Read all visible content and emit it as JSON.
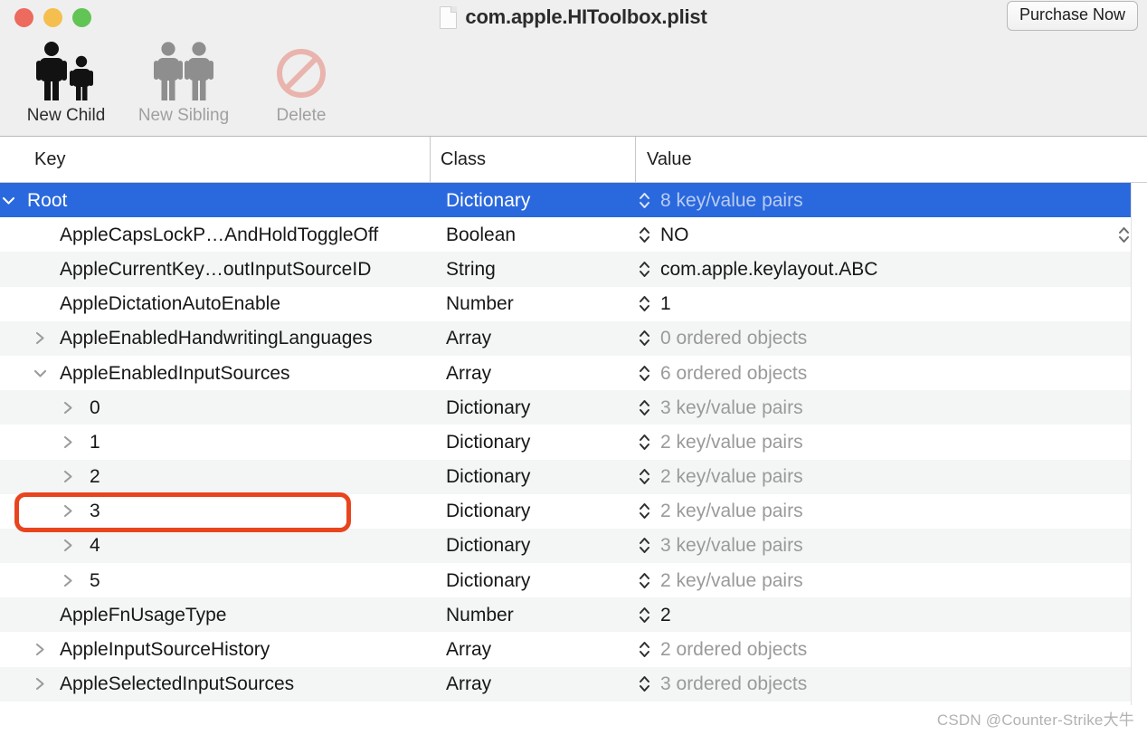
{
  "window": {
    "title": "com.apple.HIToolbox.plist",
    "traffic_lights": [
      "close",
      "minimize",
      "zoom"
    ],
    "purchase_button": "Purchase Now",
    "accent_selected": "#2a68dd",
    "annotation_color": "#e8451f"
  },
  "toolbar": {
    "items": [
      {
        "label": "New Child",
        "icon": "two-people-parent-child-icon",
        "enabled": true
      },
      {
        "label": "New Sibling",
        "icon": "two-people-siblings-icon",
        "enabled": false
      },
      {
        "label": "Delete",
        "icon": "prohibition-sign-icon",
        "enabled": false
      }
    ]
  },
  "table": {
    "columns": [
      "Key",
      "Class",
      "Value"
    ],
    "rows": [
      {
        "key": "Root",
        "class": "Dictionary",
        "value": "8 key/value pairs",
        "level": 0,
        "disclosure": "expanded",
        "selected": true,
        "muted_value": true,
        "stepper": true
      },
      {
        "key": "AppleCapsLockP…AndHoldToggleOff",
        "class": "Boolean",
        "value": "NO",
        "level": 1,
        "disclosure": "none",
        "selected": false,
        "muted_value": false,
        "stepper": true,
        "right_popup": true
      },
      {
        "key": "AppleCurrentKey…outInputSourceID",
        "class": "String",
        "value": "com.apple.keylayout.ABC",
        "level": 1,
        "disclosure": "none",
        "selected": false,
        "muted_value": false,
        "stepper": true
      },
      {
        "key": "AppleDictationAutoEnable",
        "class": "Number",
        "value": "1",
        "level": 1,
        "disclosure": "none",
        "selected": false,
        "muted_value": false,
        "stepper": true
      },
      {
        "key": "AppleEnabledHandwritingLanguages",
        "class": "Array",
        "value": "0 ordered objects",
        "level": 1,
        "disclosure": "collapsed",
        "selected": false,
        "muted_value": true,
        "stepper": true
      },
      {
        "key": "AppleEnabledInputSources",
        "class": "Array",
        "value": "6 ordered objects",
        "level": 1,
        "disclosure": "expanded",
        "selected": false,
        "muted_value": true,
        "stepper": true,
        "annotated": true
      },
      {
        "key": "0",
        "class": "Dictionary",
        "value": "3 key/value pairs",
        "level": 2,
        "disclosure": "collapsed",
        "selected": false,
        "muted_value": true,
        "stepper": true
      },
      {
        "key": "1",
        "class": "Dictionary",
        "value": "2 key/value pairs",
        "level": 2,
        "disclosure": "collapsed",
        "selected": false,
        "muted_value": true,
        "stepper": true
      },
      {
        "key": "2",
        "class": "Dictionary",
        "value": "2 key/value pairs",
        "level": 2,
        "disclosure": "collapsed",
        "selected": false,
        "muted_value": true,
        "stepper": true
      },
      {
        "key": "3",
        "class": "Dictionary",
        "value": "2 key/value pairs",
        "level": 2,
        "disclosure": "collapsed",
        "selected": false,
        "muted_value": true,
        "stepper": true
      },
      {
        "key": "4",
        "class": "Dictionary",
        "value": "3 key/value pairs",
        "level": 2,
        "disclosure": "collapsed",
        "selected": false,
        "muted_value": true,
        "stepper": true
      },
      {
        "key": "5",
        "class": "Dictionary",
        "value": "2 key/value pairs",
        "level": 2,
        "disclosure": "collapsed",
        "selected": false,
        "muted_value": true,
        "stepper": true
      },
      {
        "key": "AppleFnUsageType",
        "class": "Number",
        "value": "2",
        "level": 1,
        "disclosure": "none",
        "selected": false,
        "muted_value": false,
        "stepper": true
      },
      {
        "key": "AppleInputSourceHistory",
        "class": "Array",
        "value": "2 ordered objects",
        "level": 1,
        "disclosure": "collapsed",
        "selected": false,
        "muted_value": true,
        "stepper": true
      },
      {
        "key": "AppleSelectedInputSources",
        "class": "Array",
        "value": "3 ordered objects",
        "level": 1,
        "disclosure": "collapsed",
        "selected": false,
        "muted_value": true,
        "stepper": true
      }
    ]
  },
  "watermark": "CSDN @Counter-Strike大牛"
}
